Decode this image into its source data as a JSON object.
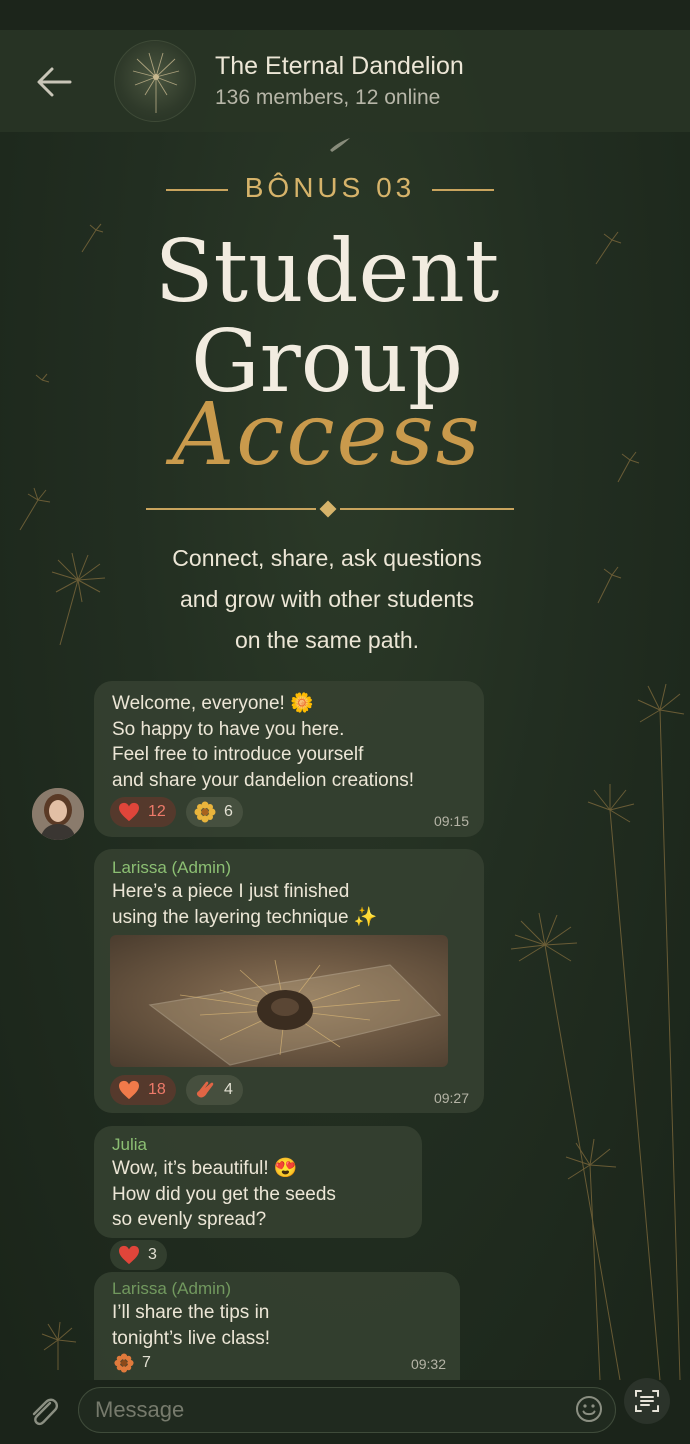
{
  "header": {
    "title": "The Eternal Dandelion",
    "subtitle": "136 members, 12 online"
  },
  "hero": {
    "bonus": "BÔNUS 03",
    "line1": "Student",
    "line2": "Group",
    "line3": "Access",
    "tagline": [
      "Connect, share, ask questions",
      "and grow with other students",
      "on the same path."
    ]
  },
  "messages": [
    {
      "lines": [
        "Welcome, everyone! 🌼",
        "So happy to have you here.",
        "Feel free to introduce yourself",
        "and share your dandelion creations!"
      ],
      "time": "09:15",
      "reactions": [
        {
          "icon": "heart-icon",
          "count": "12"
        },
        {
          "icon": "flower-icon",
          "count": "6"
        }
      ]
    },
    {
      "sender": "Larissa (Admin)",
      "lines": [
        "Here’s a piece I just finished",
        "using the layering technique ✨"
      ],
      "time": "09:27",
      "reactions": [
        {
          "icon": "heart-icon",
          "count": "18"
        },
        {
          "icon": "clap-icon",
          "count": "4"
        }
      ]
    },
    {
      "sender": "Julia",
      "lines": [
        "Wow, it’s beautiful! 😍",
        "How did you get the seeds",
        "so evenly spread?"
      ],
      "reactions": [
        {
          "icon": "heart-icon",
          "count": "3"
        }
      ]
    },
    {
      "sender": "Larissa (Admin)",
      "lines": [
        "I’ll share the tips in",
        "tonight’s live class!"
      ],
      "time": "09:32",
      "reactions": [
        {
          "icon": "flower-icon",
          "count": "7"
        }
      ]
    }
  ],
  "composer": {
    "placeholder": "Message"
  },
  "colors": {
    "background": "#222e21",
    "bubble": "#364131",
    "gold": "#c9a45e",
    "sender": "#8cbf73",
    "heart": "#e0453a"
  }
}
